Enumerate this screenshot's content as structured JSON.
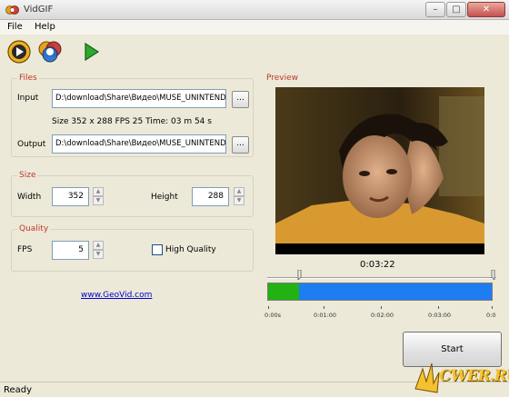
{
  "window": {
    "title": "VidGIF",
    "min": "–",
    "max": "□",
    "close": "✕"
  },
  "menu": [
    {
      "label": "File"
    },
    {
      "label": "Help"
    }
  ],
  "toolbar": [
    {
      "icon": "open-video-icon"
    },
    {
      "icon": "batch-open-icon"
    },
    {
      "icon": "play-icon"
    }
  ],
  "files": {
    "title": "Files",
    "input_label": "Input",
    "input_value": "D:\\download\\Share\\Видео\\MUSE_UNINTENDED",
    "info": "Size  352 x 288  FPS 25  Time: 03 m 54 s",
    "output_label": "Output",
    "output_value": "D:\\download\\Share\\Видео\\MUSE_UNINTENDED",
    "browse_label": "..."
  },
  "size": {
    "title": "Size",
    "width_label": "Width",
    "width": "352",
    "height_label": "Height",
    "height": "288"
  },
  "quality": {
    "title": "Quality",
    "fps_label": "FPS",
    "fps": "5",
    "hq_label": "High Quality",
    "hq_checked": false
  },
  "link": "www.GeoVid.com",
  "preview": {
    "title": "Preview",
    "time": "0:03:22",
    "progress_fraction": 0.14,
    "ticks": [
      "0:00s",
      "0:01:00",
      "0:02:00",
      "0:03:00",
      "0:0"
    ]
  },
  "start_label": "Start",
  "status": "Ready",
  "watermark": "CWER.RU",
  "colors": {
    "section_title": "#c0392b",
    "progress_done": "#22b214",
    "progress_rest": "#1e7df0",
    "link": "#0000cc"
  }
}
